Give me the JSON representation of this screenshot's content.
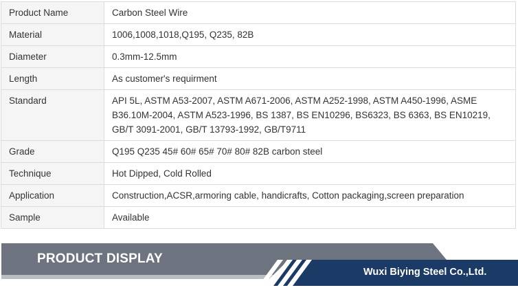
{
  "spec_table": {
    "rows": [
      {
        "label": "Product Name",
        "value": "Carbon Steel Wire"
      },
      {
        "label": "Material",
        "value": "1006,1008,1018,Q195, Q235, 82B"
      },
      {
        "label": "Diameter",
        "value": "0.3mm-12.5mm"
      },
      {
        "label": "Length",
        "value": "As customer's requirment"
      },
      {
        "label": "Standard",
        "value": "API 5L, ASTM A53-2007, ASTM A671-2006, ASTM A252-1998, ASTM A450-1996, ASME B36.10M-2004, ASTM A523-1996, BS 1387, BS EN10296, BS6323, BS 6363, BS EN10219, GB/T 3091-2001, GB/T 13793-1992, GB/T9711"
      },
      {
        "label": "Grade",
        "value": "Q195 Q235 45# 60# 65# 70# 80# 82B carbon steel"
      },
      {
        "label": "Technique",
        "value": "Hot Dipped, Cold Rolled"
      },
      {
        "label": "Application",
        "value": " Construction,ACSR,armoring cable, handicrafts, Cotton packaging,screen preparation"
      },
      {
        "label": "Sample",
        "value": "Available"
      }
    ]
  },
  "banner": {
    "title": "PRODUCT DISPLAY",
    "company": "Wuxi Biying Steel Co.,Ltd.",
    "colors": {
      "gray": "#6d7480",
      "navy": "#1b3a66"
    }
  }
}
